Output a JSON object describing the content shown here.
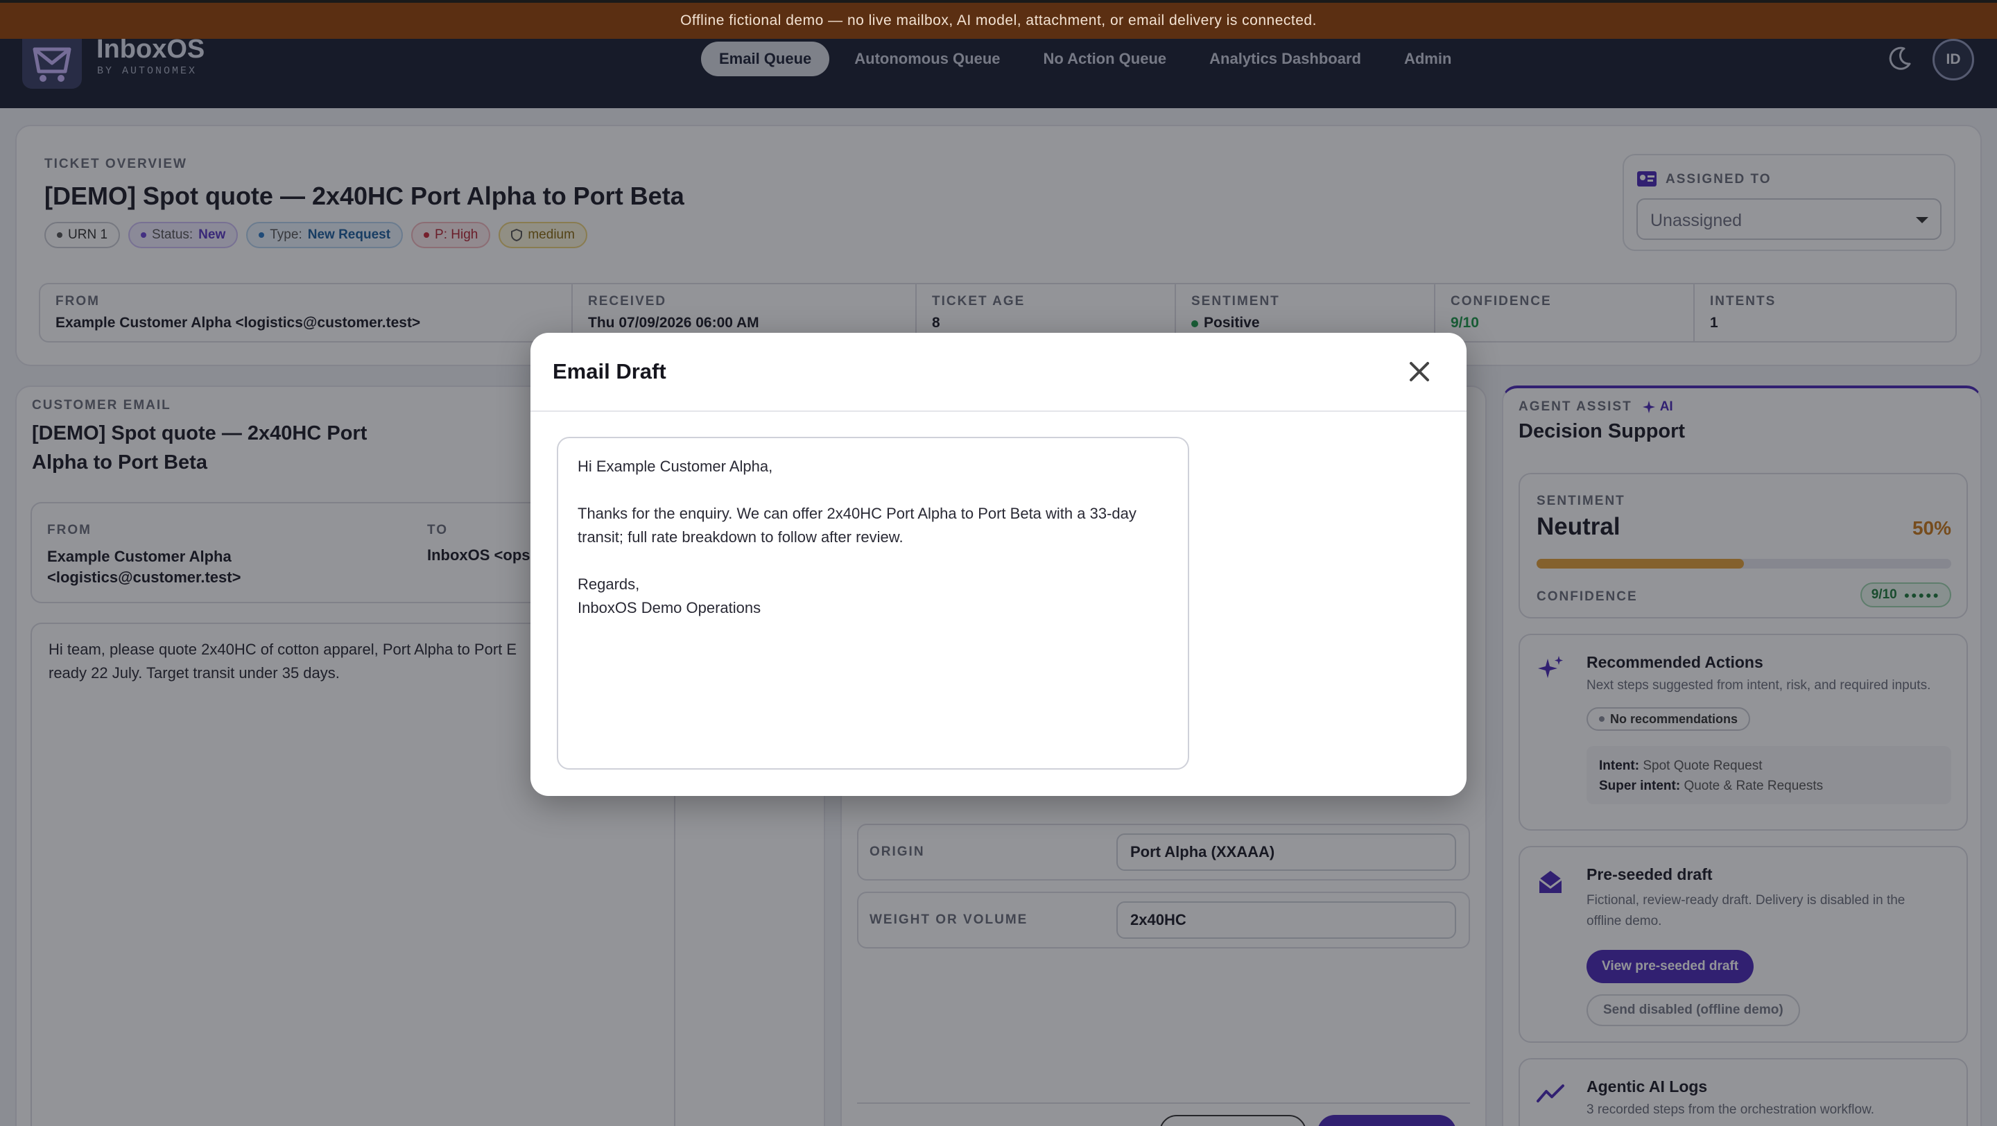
{
  "banner": {
    "text": "Offline fictional demo — no live mailbox, AI model, attachment, or email delivery is connected."
  },
  "brand": {
    "name": "InboxOS",
    "sub": "BY AUTONOMEX"
  },
  "nav": {
    "tabs": [
      "Email Queue",
      "Autonomous Queue",
      "No Action Queue",
      "Analytics Dashboard",
      "Admin"
    ],
    "active": "Email Queue",
    "avatar": "ID"
  },
  "ticket": {
    "section_label": "TICKET OVERVIEW",
    "title": "[DEMO] Spot quote — 2x40HC Port Alpha to Port Beta",
    "badges": {
      "urn": "URN 1",
      "status_key": "Status:",
      "status_val": "New",
      "type_key": "Type:",
      "type_val": "New Request",
      "priority": "P: High",
      "risk": "medium"
    },
    "assigned_label": "ASSIGNED TO",
    "assigned_value": "Unassigned",
    "meta": {
      "from_label": "FROM",
      "from": "Example Customer Alpha <logistics@customer.test>",
      "received_label": "RECEIVED",
      "received": "Thu 07/09/2026 06:00 AM",
      "age_label": "TICKET AGE",
      "age": "8",
      "sentiment_label": "SENTIMENT",
      "sentiment": "Positive",
      "confidence_label": "CONFIDENCE",
      "confidence": "9/10",
      "intents_label": "INTENTS",
      "intents": "1"
    }
  },
  "customer_email": {
    "section_label": "CUSTOMER EMAIL",
    "title": "[DEMO] Spot quote — 2x40HC Port Alpha to Port Beta",
    "from_label": "FROM",
    "from_line1": "Example Customer Alpha",
    "from_line2": "<logistics@customer.test>",
    "to_label": "TO",
    "to": "InboxOS <ops",
    "body_line1": "Hi team, please quote 2x40HC of cotton apparel, Port Alpha to Port E",
    "body_line2": "ready 22 July. Target transit under 35 days."
  },
  "fields": {
    "origin_label": "ORIGIN",
    "origin": "Port Alpha (XXAAA)",
    "weight_label": "WEIGHT OR VOLUME",
    "weight": "2x40HC"
  },
  "agent_assist": {
    "section_label": "AGENT ASSIST",
    "ai_tag": "AI",
    "title": "Decision Support",
    "sentiment_label": "SENTIMENT",
    "sentiment": "Neutral",
    "sentiment_pct": "50%",
    "sentiment_level": 0.5,
    "confidence_label": "CONFIDENCE",
    "confidence": "9/10",
    "recommended_title": "Recommended Actions",
    "recommended_desc": "Next steps suggested from intent, risk, and required inputs.",
    "no_recs": "No recommendations",
    "intent_key": "Intent:",
    "intent_val": "Spot Quote Request",
    "super_key": "Super intent:",
    "super_val": "Quote & Rate Requests",
    "draft_title": "Pre-seeded draft",
    "draft_desc_1": "Fictional, review-ready draft. Delivery is disabled in the",
    "draft_desc_2": "offline demo.",
    "view_draft_btn": "View pre-seeded draft",
    "send_disabled_btn": "Send disabled (offline demo)",
    "logs_title": "Agentic AI Logs",
    "logs_desc": "3 recorded steps from the orchestration workflow."
  },
  "modal": {
    "title": "Email Draft",
    "greeting": "Hi Example Customer Alpha,",
    "para1_line1": "Thanks for the enquiry. We can offer 2x40HC Port Alpha to Port Beta with a 33-day",
    "para1_line2": "transit; full rate breakdown to follow after review.",
    "closing": "Regards,",
    "signature": "InboxOS Demo Operations"
  },
  "colors": {
    "accent": "#4b2ab8",
    "nav_bg": "#1b2133",
    "banner_bg": "#5b2f12",
    "positive": "#1e9a4a",
    "neutral": "#c97a1c"
  }
}
